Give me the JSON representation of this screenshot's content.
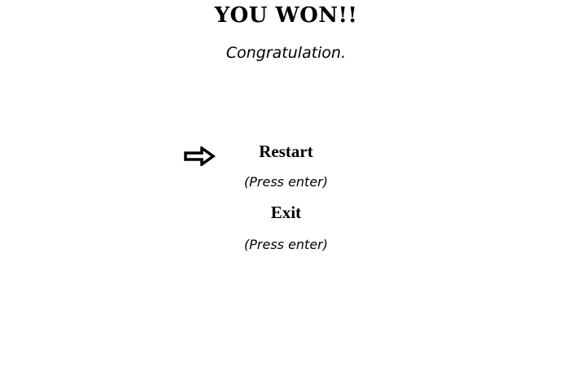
{
  "header": {
    "title": "YOU WON!!",
    "subtitle": "Congratulation."
  },
  "menu": {
    "selected_icon": "right-arrow-icon",
    "items": [
      {
        "label": "Restart",
        "hint": "(Press enter)"
      },
      {
        "label": "Exit",
        "hint": "(Press enter)"
      }
    ]
  }
}
